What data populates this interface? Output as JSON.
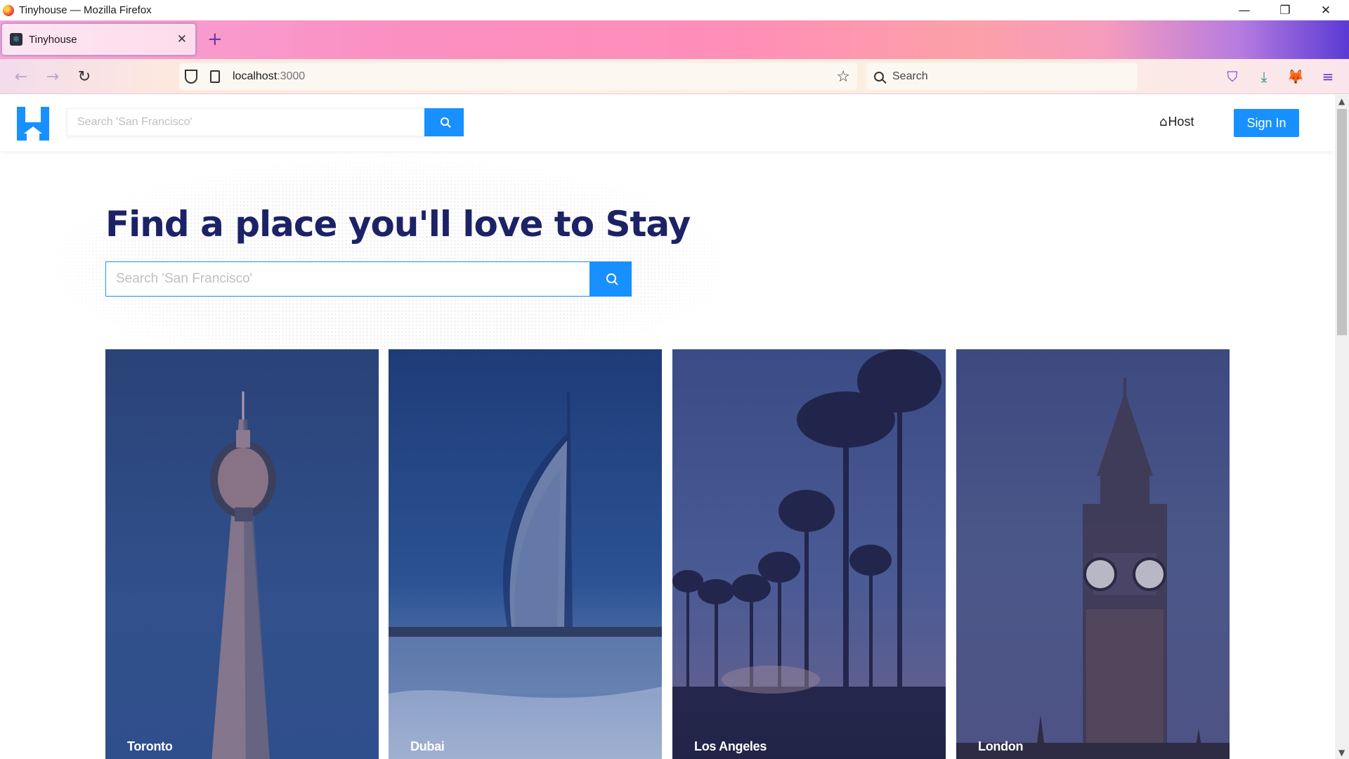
{
  "window": {
    "title": "Tinyhouse — Mozilla Firefox",
    "minimize": "—",
    "restore": "❐",
    "close": "✕"
  },
  "tab": {
    "icon": "react-icon",
    "title": "Tinyhouse",
    "close": "✕",
    "new_tab": "+"
  },
  "toolbar": {
    "back": "←",
    "forward": "→",
    "reload": "↻",
    "url_host": "localhost",
    "url_port": ":3000",
    "bookmark_star": "☆",
    "search_placeholder": "Search"
  },
  "app": {
    "header": {
      "search_placeholder": "Search 'San Francisco'",
      "host_label": "Host",
      "sign_in_label": "Sign In"
    },
    "hero": {
      "title": "Find a place you'll love to Stay",
      "search_placeholder": "Search 'San Francisco'"
    },
    "cities": [
      {
        "name": "Toronto"
      },
      {
        "name": "Dubai"
      },
      {
        "name": "Los Angeles"
      },
      {
        "name": "London"
      }
    ]
  },
  "colors": {
    "primary": "#1890ff",
    "hero_title": "#1c2265"
  }
}
